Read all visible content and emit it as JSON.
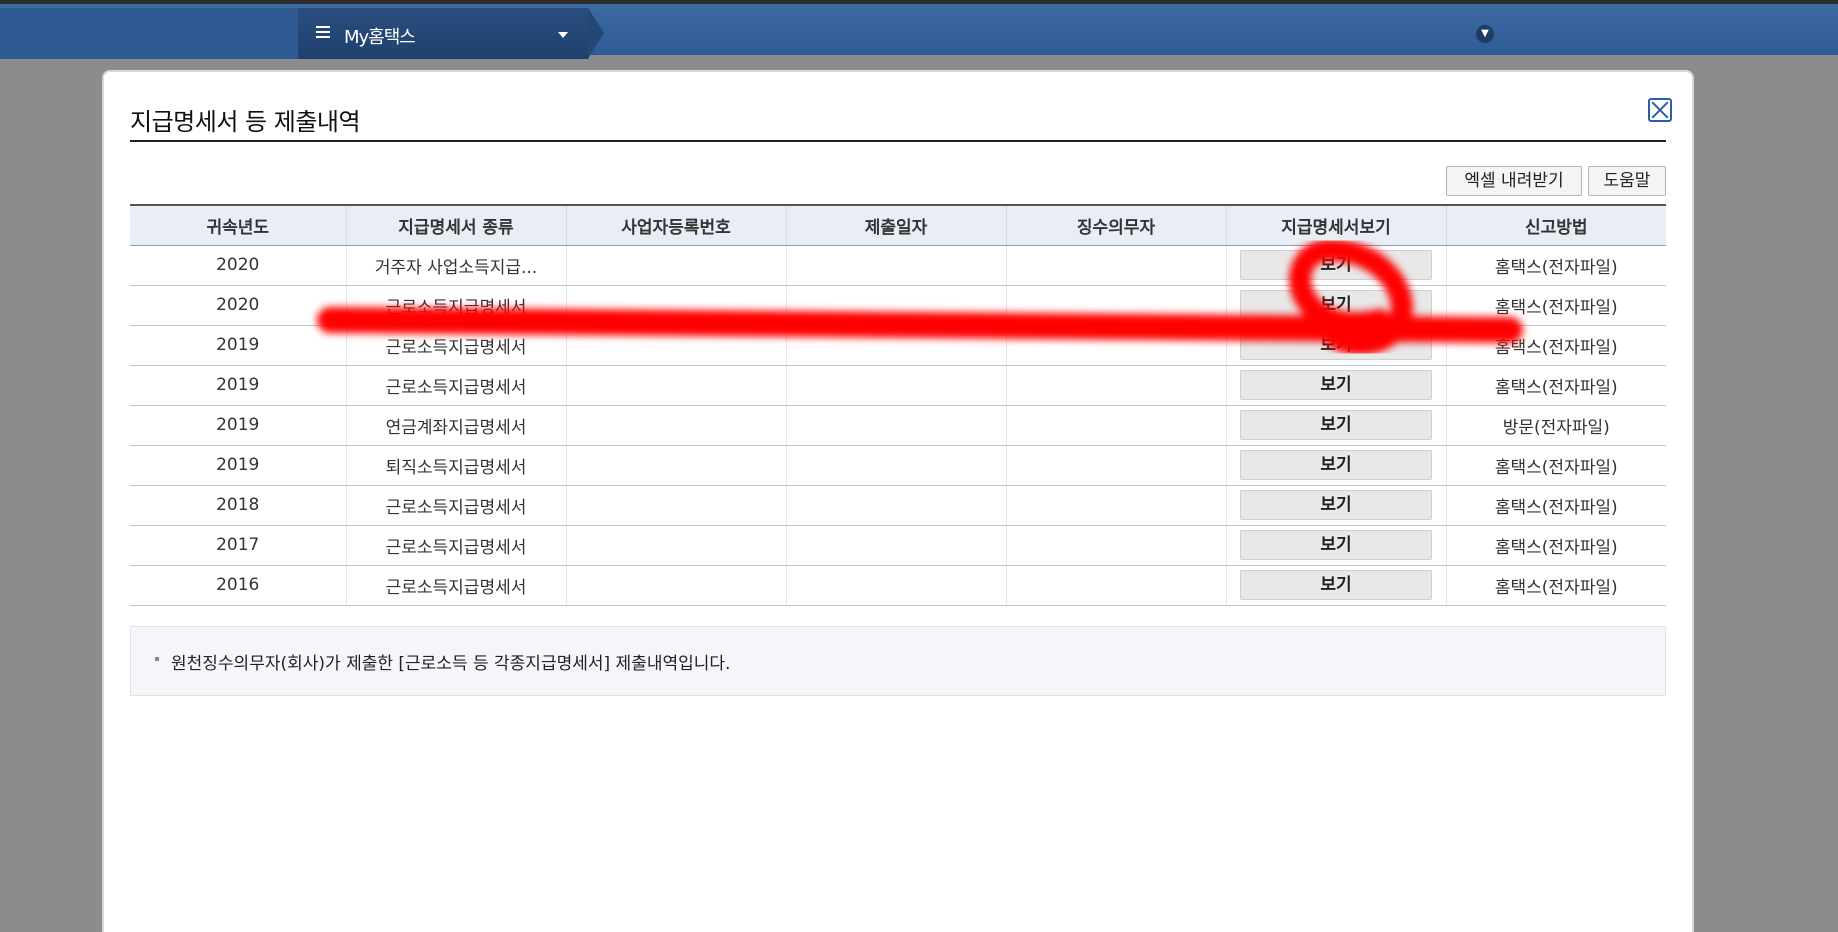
{
  "nav": {
    "menu_label": "My홈택스"
  },
  "modal": {
    "title": "지급명세서 등 제출내역",
    "buttons": {
      "excel": "엑셀 내려받기",
      "help": "도움말"
    },
    "table": {
      "headers": [
        "귀속년도",
        "지급명세서 종류",
        "사업자등록번호",
        "제출일자",
        "징수의무자",
        "지급명세서보기",
        "신고방법"
      ],
      "view_label": "보기",
      "rows": [
        {
          "year": "2020",
          "type": "거주자 사업소득지급...",
          "method": "홈택스(전자파일)"
        },
        {
          "year": "2020",
          "type": "근로소득지급명세서",
          "method": "홈택스(전자파일)"
        },
        {
          "year": "2019",
          "type": "근로소득지급명세서",
          "method": "홈택스(전자파일)"
        },
        {
          "year": "2019",
          "type": "근로소득지급명세서",
          "method": "홈택스(전자파일)"
        },
        {
          "year": "2019",
          "type": "연금계좌지급명세서",
          "method": "방문(전자파일)"
        },
        {
          "year": "2019",
          "type": "퇴직소득지급명세서",
          "method": "홈택스(전자파일)"
        },
        {
          "year": "2018",
          "type": "근로소득지급명세서",
          "method": "홈택스(전자파일)"
        },
        {
          "year": "2017",
          "type": "근로소득지급명세서",
          "method": "홈택스(전자파일)"
        },
        {
          "year": "2016",
          "type": "근로소득지급명세서",
          "method": "홈택스(전자파일)"
        }
      ]
    },
    "note": "원천징수의무자(회사)가 제출한 [근로소득 등 각종지급명세서] 제출내역입니다."
  },
  "colors": {
    "nav_bar": "#2f5b94",
    "menu_block": "#1f416f",
    "header_bg": "#e9eef6",
    "redaction": "#ff0000"
  },
  "icons": [
    "hamburger-icon",
    "chevron-down-icon",
    "close-icon"
  ]
}
